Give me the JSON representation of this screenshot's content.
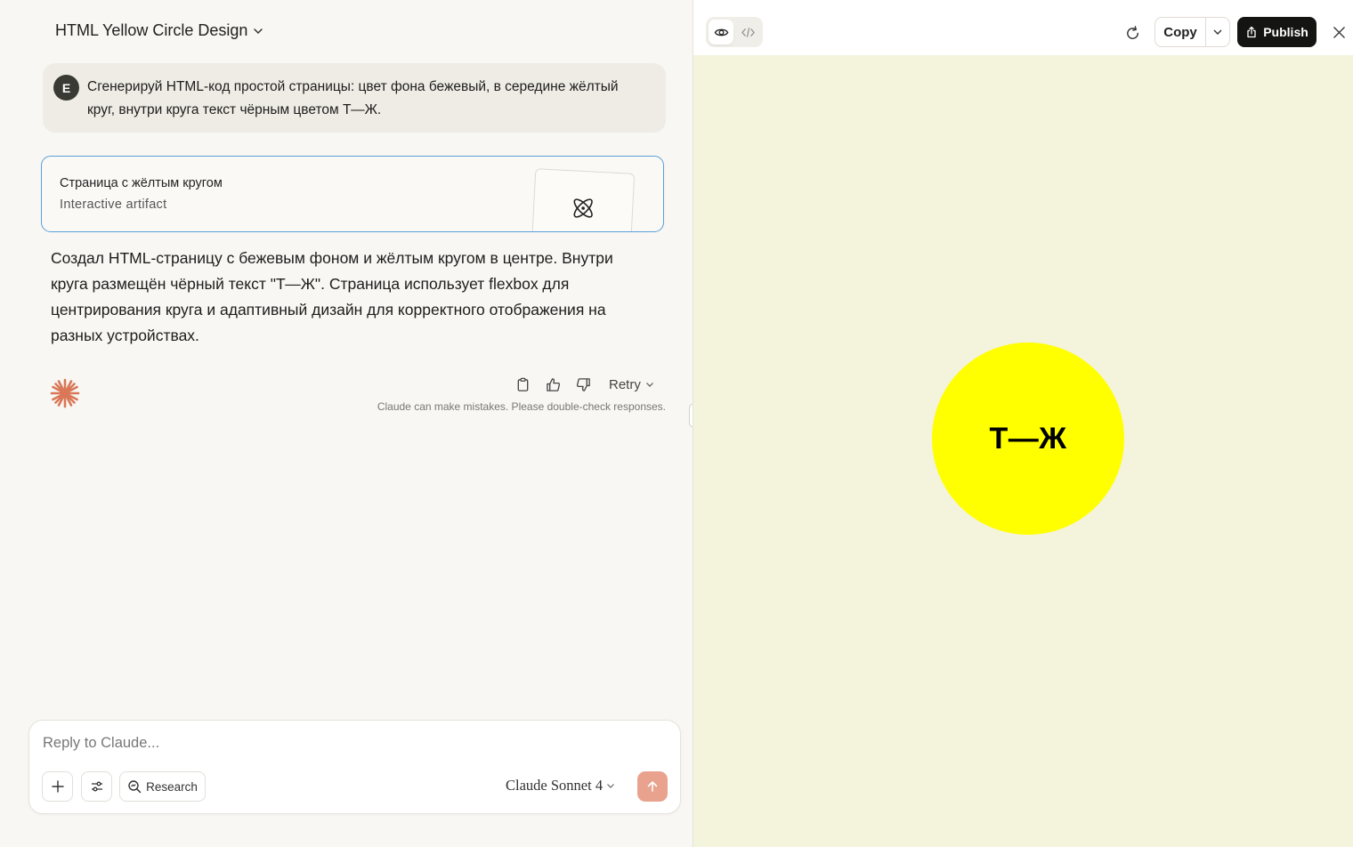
{
  "conversation": {
    "title": "HTML Yellow Circle Design",
    "user": {
      "avatar_initial": "E",
      "message": "Сгенерируй HTML-код простой страницы: цвет фона бежевый, в середине жёлтый круг, внутри круга текст чёрным цветом Т—Ж."
    },
    "artifact": {
      "title": "Страница с жёлтым кругом",
      "subtitle": "Interactive artifact",
      "icon": "react-atom-icon"
    },
    "answer": "Создал HTML-страницу с бежевым фоном и жёлтым кругом в центре. Внутри круга размещён чёрный текст \"Т—Ж\". Страница использует flexbox для центрирования круга и адаптивный дизайн для корректного отображения на разных устройствах.",
    "actions": {
      "retry_label": "Retry"
    },
    "disclaimer": "Claude can make mistakes. Please double-check responses."
  },
  "composer": {
    "placeholder": "Reply to Claude...",
    "research_label": "Research",
    "model_label": "Claude Sonnet 4"
  },
  "preview": {
    "copy_label": "Copy",
    "publish_label": "Publish",
    "circle_text": "Т—Ж",
    "colors": {
      "background": "#f4f3dc",
      "circle": "#ffff00",
      "text": "#000000"
    }
  },
  "colors": {
    "accent": "#d97757",
    "send_button": "#e9a28e",
    "artifact_border": "#5a9fd8"
  }
}
